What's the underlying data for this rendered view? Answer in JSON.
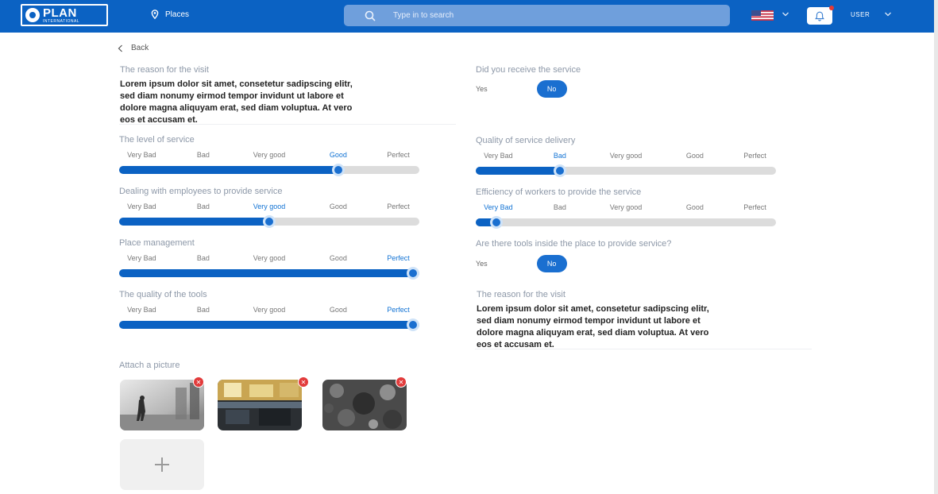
{
  "header": {
    "logo_text": "PLAN",
    "logo_subtext": "INTERNATIONAL",
    "places_label": "Places",
    "search_placeholder": "Type in to search",
    "user_label": "USER"
  },
  "nav": {
    "back_label": "Back"
  },
  "left": {
    "visit_reason": {
      "label": "The reason for the visit",
      "text_lines": [
        "Lorem ipsum dolor sit amet, consetetur sadipscing elitr,",
        "sed diam nonumy eirmod tempor invidunt ut labore et",
        "dolore magna aliquyam erat, sed diam voluptua. At vero",
        "eos et accusam et."
      ]
    },
    "ratings": [
      {
        "label": "The level of service",
        "selected": "Good",
        "value": 0.73
      },
      {
        "label": "Dealing with employees to provide service",
        "selected": "Very good",
        "value": 0.5
      },
      {
        "label": "Place management",
        "selected": "Perfect",
        "value": 1.0
      },
      {
        "label": "The quality of the tools",
        "selected": "Perfect",
        "value": 1.0
      }
    ],
    "attach_label": "Attach a picture",
    "pictures": [
      {
        "name": "smoke-street-photo"
      },
      {
        "name": "indoor-room-photo"
      },
      {
        "name": "rubble-photo"
      }
    ]
  },
  "right": {
    "received_service": {
      "label": "Did you receive the service",
      "yes": "Yes",
      "no": "No",
      "selected": "No"
    },
    "ratings": [
      {
        "label": "Quality of service delivery",
        "selected": "Bad",
        "value": 0.28
      },
      {
        "label": "Efficiency of workers to provide the service",
        "selected": "Very Bad",
        "value": 0.07
      }
    ],
    "tools_inside": {
      "label": "Are there tools inside the place to provide service?",
      "yes": "Yes",
      "no": "No",
      "selected": "No"
    },
    "visit_reason": {
      "label": "The reason for the visit",
      "text_lines": [
        "Lorem ipsum dolor sit amet, consetetur sadipscing elitr,",
        "sed diam nonumy eirmod tempor invidunt ut labore et",
        "dolore magna aliquyam erat, sed diam voluptua. At vero",
        "eos et accusam et."
      ]
    }
  },
  "scale_labels": [
    "Very Bad",
    "Bad",
    "Very good",
    "Good",
    "Perfect"
  ],
  "colors": {
    "primary": "#0b62c3",
    "accent": "#1a6fd0",
    "remove": "#e23b3b"
  }
}
